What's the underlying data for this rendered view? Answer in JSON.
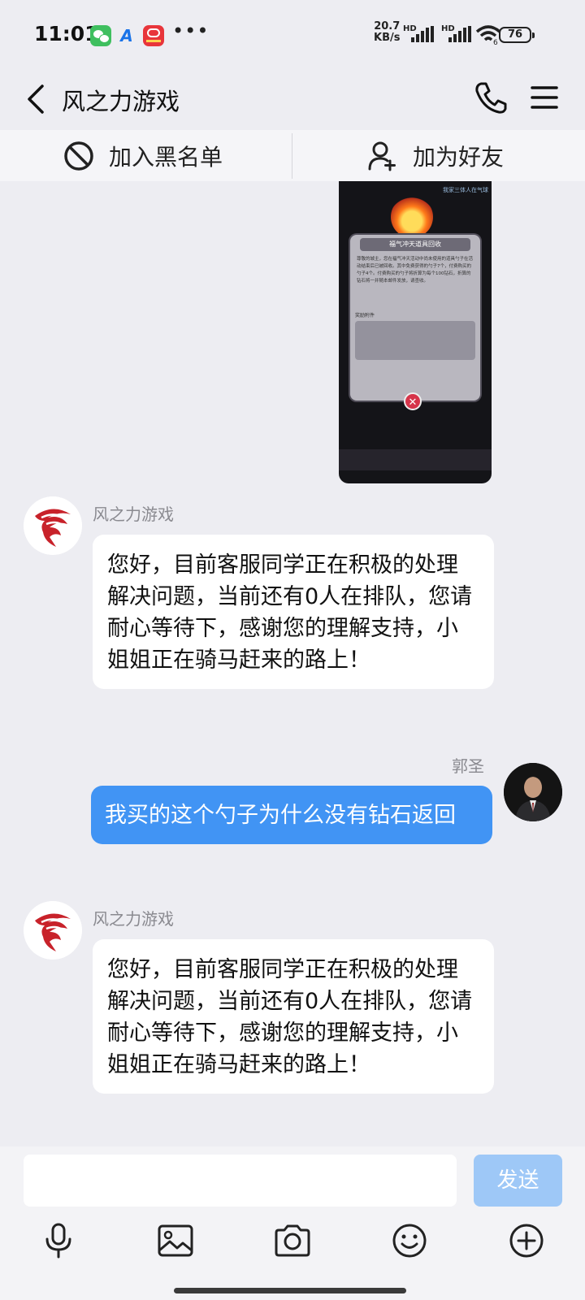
{
  "status_bar": {
    "time": "11:01",
    "net_speed_value": "20.7",
    "net_speed_unit": "KB/s",
    "hd_label": "HD",
    "wifi_label": "6",
    "battery": "76"
  },
  "header": {
    "title": "风之力游戏"
  },
  "actions": {
    "blacklist": "加入黑名单",
    "add_friend": "加为好友"
  },
  "screenshot_image": {
    "top_text": "我家三体人在气球",
    "panel_title": "福气冲天道具回收",
    "panel_text": "尊敬的城主，您在福气冲天活动中尚未使用的道具勺子在活动结束后已被回收。其中免费获得的勺子7个，付费购买的勺子4个。付费购买的勺子将折算为每个100钻石，折算的钻石将一并随本邮件发放，请查收。",
    "attachment_label": "奖励附件"
  },
  "messages": [
    {
      "sender": "风之力游戏",
      "side": "left",
      "text": "您好，目前客服同学正在积极的处理解决问题，当前还有0人在排队，您请耐心等待下，感谢您的理解支持，小姐姐正在骑马赶来的路上！"
    },
    {
      "sender": "郭圣",
      "side": "right",
      "text": "我买的这个勺子为什么没有钻石返回"
    },
    {
      "sender": "风之力游戏",
      "side": "left",
      "text": "您好，目前客服同学正在积极的处理解决问题，当前还有0人在排队，您请耐心等待下，感谢您的理解支持，小姐姐正在骑马赶来的路上！"
    }
  ],
  "composer": {
    "input_value": "",
    "input_placeholder": "",
    "send_label": "发送"
  },
  "toolbar": [
    "microphone-icon",
    "image-icon",
    "camera-icon",
    "emoji-icon",
    "plus-icon"
  ],
  "colors": {
    "background": "#ededf2",
    "outgoing_bubble": "#4194f4",
    "send_button_disabled": "#9ec8f7"
  }
}
